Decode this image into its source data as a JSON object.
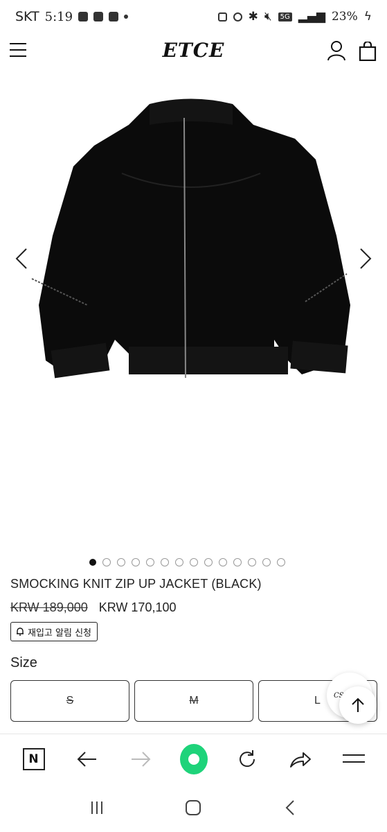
{
  "status_bar": {
    "carrier": "SKT",
    "time": "5:19",
    "network": "5G",
    "battery": "23%"
  },
  "header": {
    "logo": "ETCE",
    "icons": [
      "menu-icon",
      "user-icon",
      "shopping-bag-icon"
    ]
  },
  "carousel": {
    "image": "black-smocking-knit-zip-up-jacket",
    "total_slides": 14,
    "active_index": 0
  },
  "product": {
    "name": "SMOCKING KNIT ZIP UP JACKET (BLACK)",
    "original_price": "KRW 189,000",
    "sale_price": "KRW 170,100",
    "restock_label": "재입고 알림 신청"
  },
  "size": {
    "label": "Size",
    "options": [
      {
        "label": "S",
        "sold_out": true
      },
      {
        "label": "M",
        "sold_out": true
      },
      {
        "label": "L",
        "sold_out": false
      }
    ]
  },
  "floating": {
    "cs_label": "CS"
  },
  "browser_toolbar": {
    "icons": [
      "naver-icon",
      "back-arrow-icon",
      "forward-arrow-icon",
      "green-dot-icon",
      "refresh-icon",
      "share-icon",
      "hamburger-icon"
    ]
  },
  "android_nav": {
    "icons": [
      "recent-apps-icon",
      "home-icon",
      "back-icon"
    ]
  },
  "colors": {
    "accent_green": "#1ed37a",
    "text": "#111111"
  }
}
